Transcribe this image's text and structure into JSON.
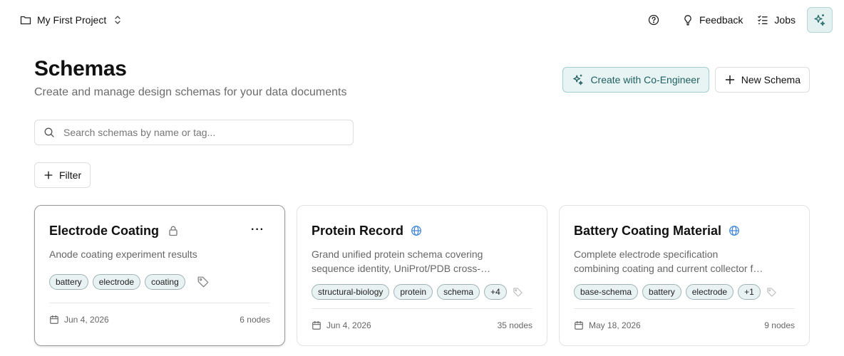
{
  "topbar": {
    "project_name": "My First Project",
    "feedback_label": "Feedback",
    "jobs_label": "Jobs"
  },
  "header": {
    "title": "Schemas",
    "subtitle": "Create and manage design schemas for your data documents"
  },
  "actions": {
    "co_engineer_label": "Create with Co-Engineer",
    "new_schema_label": "New Schema"
  },
  "search": {
    "placeholder": "Search schemas by name or tag..."
  },
  "filter": {
    "label": "Filter"
  },
  "cards": [
    {
      "title": "Electrode Coating",
      "visibility_icon": "lock-icon",
      "description_lines": [
        "Anode coating experiment results"
      ],
      "tags": [
        "battery",
        "electrode",
        "coating"
      ],
      "date": "Jun 4, 2026",
      "nodes": "6 nodes",
      "more": "···"
    },
    {
      "title": "Protein Record",
      "visibility_icon": "globe-icon",
      "description_lines": [
        "Grand unified protein schema covering",
        "sequence identity, UniProt/PDB cross-…"
      ],
      "tags": [
        "structural-biology",
        "protein",
        "schema",
        "+4"
      ],
      "date": "Jun 4, 2026",
      "nodes": "35 nodes"
    },
    {
      "title": "Battery Coating Material",
      "visibility_icon": "globe-icon",
      "description_lines": [
        "Complete electrode specification",
        "combining coating and current collector f…"
      ],
      "tags": [
        "base-schema",
        "battery",
        "electrode",
        "+1"
      ],
      "date": "May 18, 2026",
      "nodes": "9 nodes"
    }
  ],
  "colors": {
    "accent_bg": "#e8f4f4",
    "accent_border": "#9fcfcf",
    "accent_text": "#1f5f5f",
    "globe_blue": "#3b82d6",
    "tag_bg": "#e9f2f3"
  }
}
